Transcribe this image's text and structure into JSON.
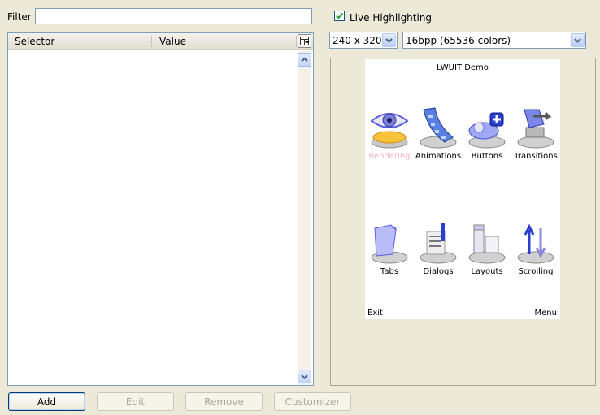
{
  "filter": {
    "label": "Filter",
    "value": ""
  },
  "table": {
    "columns": [
      "Selector",
      "Value"
    ],
    "rows": []
  },
  "live_highlighting": {
    "label": "Live Highlighting",
    "checked": true
  },
  "resolution": {
    "selected": "240 x 320"
  },
  "color_depth": {
    "selected": "16bpp (65536 colors)"
  },
  "preview": {
    "title": "LWUIT Demo",
    "items": [
      {
        "label": "Rendering",
        "icon": "eye-icon",
        "selected": true
      },
      {
        "label": "Animations",
        "icon": "film-strip-icon",
        "selected": false
      },
      {
        "label": "Buttons",
        "icon": "plus-button-icon",
        "selected": false
      },
      {
        "label": "Transitions",
        "icon": "transition-arrow-icon",
        "selected": false
      },
      {
        "label": "Tabs",
        "icon": "folder-icon",
        "selected": false
      },
      {
        "label": "Dialogs",
        "icon": "dialog-list-icon",
        "selected": false
      },
      {
        "label": "Layouts",
        "icon": "layout-blocks-icon",
        "selected": false
      },
      {
        "label": "Scrolling",
        "icon": "scroll-arrows-icon",
        "selected": false
      }
    ],
    "softkey_left": "Exit",
    "softkey_right": "Menu",
    "selected_label_color": "#f4b4c4",
    "icon_color": "#5a5adf"
  },
  "buttons": {
    "add": "Add",
    "edit": "Edit",
    "remove": "Remove",
    "customizer": "Customizer"
  }
}
